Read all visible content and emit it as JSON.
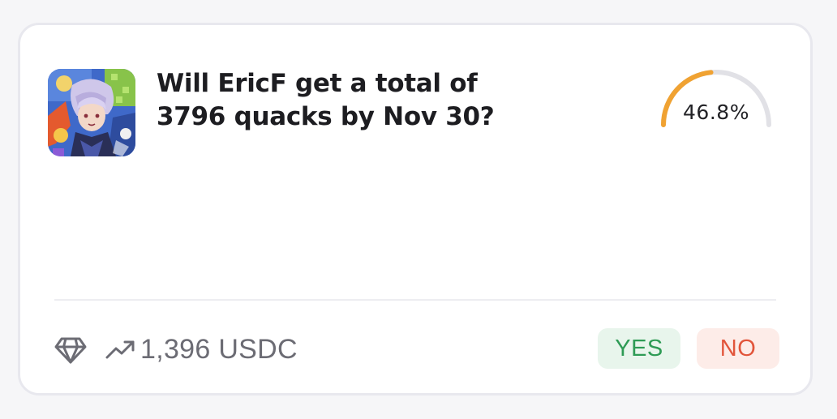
{
  "market": {
    "question": "Will EricF get a total of 3796 quacks by Nov 30?",
    "thumbnail_icon": "anime-character-artwork",
    "probability_label": "46.8%",
    "probability_fraction": 0.468
  },
  "footer": {
    "diamond_icon": "diamond-icon",
    "trend_icon": "trending-up-icon",
    "volume": "1,396 USDC"
  },
  "actions": {
    "yes_label": "YES",
    "no_label": "NO"
  },
  "colors": {
    "gauge_fill": "#f0a232",
    "gauge_track": "#e1e1e6",
    "yes_text": "#2e9b55",
    "yes_bg": "#e8f5ec",
    "no_text": "#e2553b",
    "no_bg": "#fdece8"
  }
}
